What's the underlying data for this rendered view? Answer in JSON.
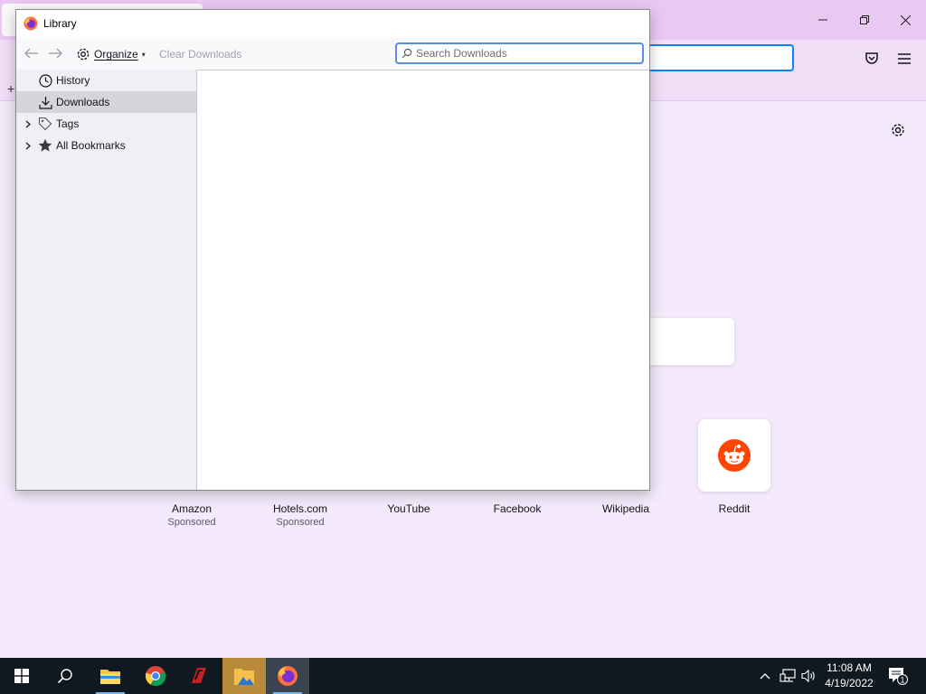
{
  "browser": {
    "top_sites": [
      {
        "title": "Amazon",
        "sponsor": "Sponsored"
      },
      {
        "title": "Hotels.com",
        "sponsor": "Sponsored"
      },
      {
        "title": "YouTube",
        "sponsor": ""
      },
      {
        "title": "Facebook",
        "sponsor": ""
      },
      {
        "title": "Wikipedia",
        "sponsor": ""
      },
      {
        "title": "Reddit",
        "sponsor": ""
      }
    ],
    "colors": {
      "titlebar": "#e9c8f2",
      "page": "#f4eafb",
      "accent": "#0a84ff",
      "reddit": "#ff4500"
    }
  },
  "library": {
    "title": "Library",
    "toolbar": {
      "organize_label": "Organize",
      "clear_label": "Clear Downloads",
      "search_placeholder": "Search Downloads"
    },
    "sidebar": {
      "items": [
        {
          "label": "History",
          "icon": "clock-icon",
          "expandable": false,
          "selected": false
        },
        {
          "label": "Downloads",
          "icon": "download-icon",
          "expandable": false,
          "selected": true
        },
        {
          "label": "Tags",
          "icon": "tag-icon",
          "expandable": true,
          "selected": false
        },
        {
          "label": "All Bookmarks",
          "icon": "star-icon",
          "expandable": true,
          "selected": false
        }
      ]
    }
  },
  "taskbar": {
    "time": "11:08 AM",
    "date": "4/19/2022",
    "notification_count": "1",
    "apps": [
      "start-icon",
      "search-icon",
      "file-explorer-icon",
      "chrome-icon",
      "app-icon",
      "photos-icon",
      "firefox-icon"
    ]
  }
}
